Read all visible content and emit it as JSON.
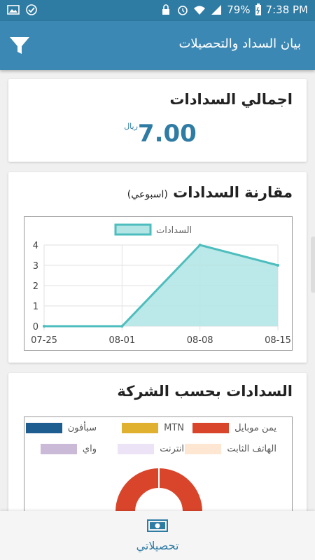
{
  "status_bar": {
    "battery": "79%",
    "time": "7:38 PM"
  },
  "app_bar": {
    "title": "بيان السداد والتحصيلات",
    "filter_icon": "filter-icon"
  },
  "total_card": {
    "title": "اجمالي السدادات",
    "value": "7.00",
    "currency": "ريال"
  },
  "compare_card": {
    "title": "مقارنة السدادات",
    "subtitle": "(اسبوعي)"
  },
  "chart_data": {
    "type": "area",
    "categories": [
      "07-25",
      "08-01",
      "08-08",
      "08-15"
    ],
    "series": [
      {
        "name": "السدادات",
        "values": [
          0,
          0,
          4,
          3
        ]
      }
    ],
    "ylim": [
      0,
      4
    ],
    "yticks": [
      "0",
      "1",
      "2",
      "3",
      "4"
    ],
    "grid": true,
    "legend": "top",
    "colors": {
      "line": "#4dbdbd",
      "fill": "#b4e5e5"
    }
  },
  "company_card": {
    "title": "السدادات بحسب الشركة",
    "legend": [
      {
        "label": "يمن موبايل",
        "color": "#d9452b"
      },
      {
        "label": "MTN",
        "color": "#e0b12e"
      },
      {
        "label": "سبأفون",
        "color": "#1d5d8f"
      },
      {
        "label": "الهاتف الثابت",
        "color": "#fde6d2"
      },
      {
        "label": "انترنت",
        "color": "#ece3f7"
      },
      {
        "label": "واي",
        "color": "#cbb9d8"
      }
    ],
    "donut_color": "#d9452b"
  },
  "bottom_nav": {
    "label": "تحصيلاتي",
    "icon": "money-icon"
  }
}
